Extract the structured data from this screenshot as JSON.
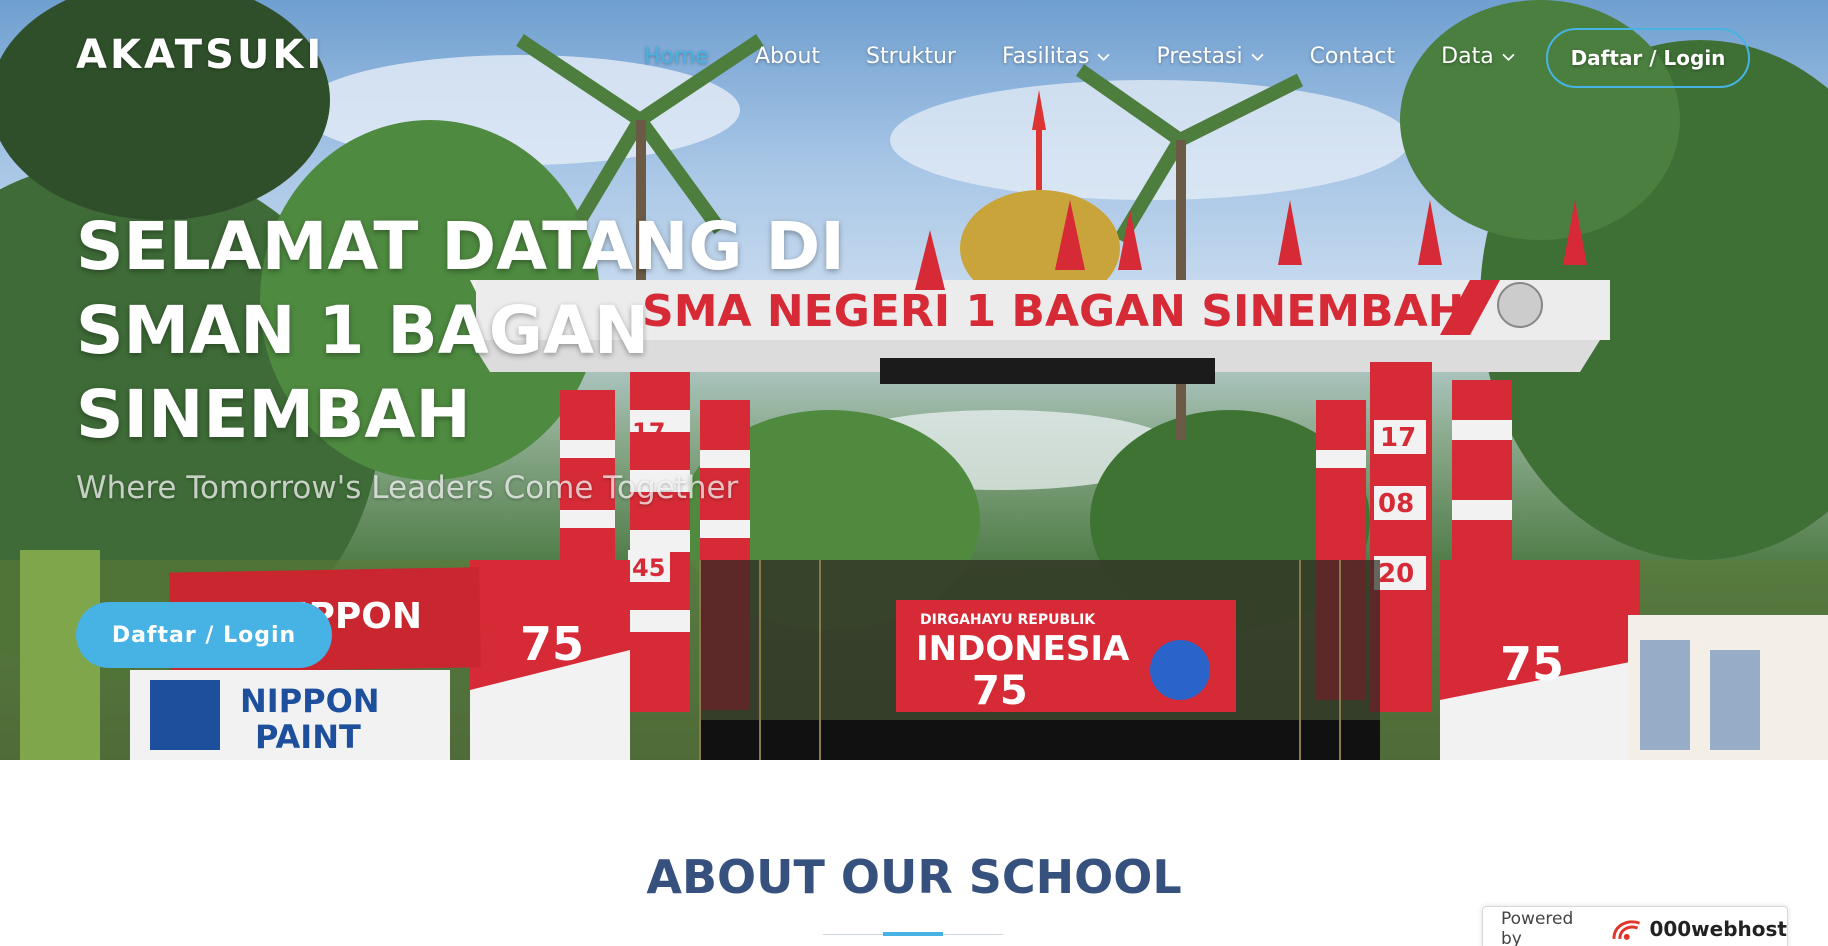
{
  "nav": {
    "logo": "AKATSUKI",
    "items": [
      {
        "label": "Home",
        "active": true,
        "dropdown": false
      },
      {
        "label": "About",
        "active": false,
        "dropdown": false
      },
      {
        "label": "Struktur",
        "active": false,
        "dropdown": false
      },
      {
        "label": "Fasilitas",
        "active": false,
        "dropdown": true
      },
      {
        "label": "Prestasi",
        "active": false,
        "dropdown": true
      },
      {
        "label": "Contact",
        "active": false,
        "dropdown": false
      },
      {
        "label": "Data",
        "active": false,
        "dropdown": true
      }
    ],
    "cta": "Daftar / Login"
  },
  "hero": {
    "title_lines": [
      "SELAMAT DATANG DI",
      "SMAN 1 BAGAN",
      "SINEMBAH"
    ],
    "subtitle": "Where Tomorrow's Leaders Come Together",
    "button": "Daftar / Login",
    "photo": {
      "gate_sign": "SMA NEGERI 1 BAGAN SINEMBAH",
      "pillar_left": "17 45",
      "pillar_right": [
        "17",
        "08",
        "20"
      ],
      "banner_top": "DIRGAHAYU REPUBLIK",
      "banner_main": "INDONESIA",
      "banner_num": "75",
      "nippon": [
        "NIPPON",
        "PAINT"
      ],
      "seventyfive": "75"
    }
  },
  "about": {
    "title": "ABOUT OUR SCHOOL"
  },
  "badge": {
    "powered_by": "Powered by",
    "brand": "000webhost"
  },
  "colors": {
    "accent": "#47b2e4",
    "heading": "#37517e",
    "gate_red": "#d62b36"
  }
}
